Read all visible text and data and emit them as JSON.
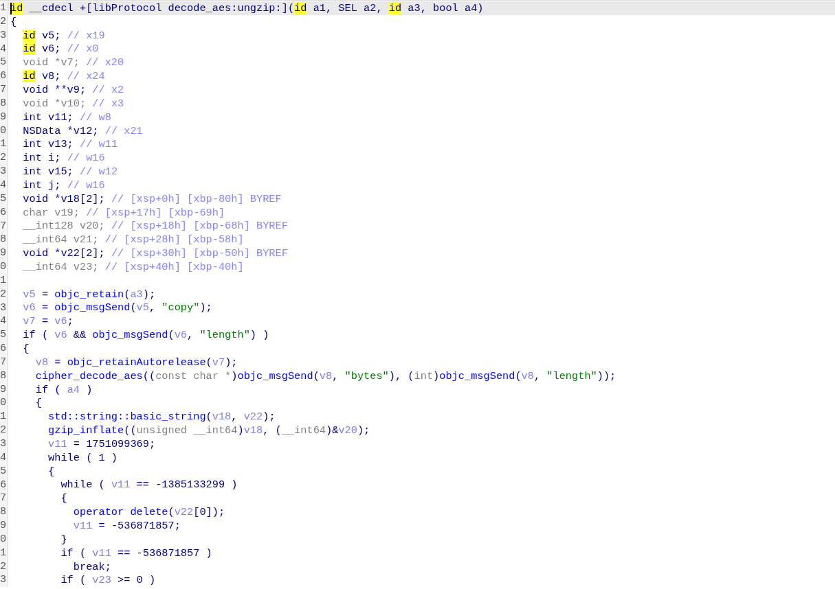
{
  "lines": [
    {
      "number": "1",
      "current": true,
      "tokens": [
        {
          "kind": "hl",
          "text": "id"
        },
        {
          "kind": "plain",
          "text": " __cdecl +[libProtocol decode_aes:ungzip:]("
        },
        {
          "kind": "hl",
          "text": "id"
        },
        {
          "kind": "plain",
          "text": " a1, SEL a2, "
        },
        {
          "kind": "hl",
          "text": "id"
        },
        {
          "kind": "plain",
          "text": " a3, bool a4)"
        }
      ]
    },
    {
      "number": "2",
      "current": false,
      "tokens": [
        {
          "kind": "plain",
          "text": "{"
        }
      ]
    },
    {
      "number": "3",
      "current": false,
      "tokens": [
        {
          "kind": "hl",
          "text": "  id"
        },
        {
          "kind": "plain",
          "text": " v5; "
        },
        {
          "kind": "comment",
          "text": "// x19"
        }
      ]
    },
    {
      "number": "4",
      "current": false,
      "tokens": [
        {
          "kind": "hl",
          "text": "  id"
        },
        {
          "kind": "plain",
          "text": " v6; "
        },
        {
          "kind": "comment",
          "text": "// x0"
        }
      ]
    },
    {
      "number": "5",
      "current": false,
      "tokens": [
        {
          "kind": "grey",
          "text": "  void *v7; "
        },
        {
          "kind": "comment",
          "text": "// x20"
        }
      ]
    },
    {
      "number": "6",
      "current": false,
      "tokens": [
        {
          "kind": "hl",
          "text": "  id"
        },
        {
          "kind": "plain",
          "text": " v8; "
        },
        {
          "kind": "comment",
          "text": "// x24"
        }
      ]
    },
    {
      "number": "7",
      "current": false,
      "tokens": [
        {
          "kind": "plain",
          "text": "  void **v9; "
        },
        {
          "kind": "comment",
          "text": "// x2"
        }
      ]
    },
    {
      "number": "8",
      "current": false,
      "tokens": [
        {
          "kind": "grey",
          "text": "  void *v10; "
        },
        {
          "kind": "comment",
          "text": "// x3"
        }
      ]
    },
    {
      "number": "9",
      "current": false,
      "tokens": [
        {
          "kind": "plain",
          "text": "  int v11; "
        },
        {
          "kind": "comment",
          "text": "// w8"
        }
      ]
    },
    {
      "number": "0",
      "current": false,
      "tokens": [
        {
          "kind": "plain",
          "text": "  NSData *v12; "
        },
        {
          "kind": "comment",
          "text": "// x21"
        }
      ]
    },
    {
      "number": "1",
      "current": false,
      "tokens": [
        {
          "kind": "plain",
          "text": "  int v13; "
        },
        {
          "kind": "comment",
          "text": "// w11"
        }
      ]
    },
    {
      "number": "2",
      "current": false,
      "tokens": [
        {
          "kind": "plain",
          "text": "  int i; "
        },
        {
          "kind": "comment",
          "text": "// w16"
        }
      ]
    },
    {
      "number": "3",
      "current": false,
      "tokens": [
        {
          "kind": "plain",
          "text": "  int v15; "
        },
        {
          "kind": "comment",
          "text": "// w12"
        }
      ]
    },
    {
      "number": "4",
      "current": false,
      "tokens": [
        {
          "kind": "plain",
          "text": "  int j; "
        },
        {
          "kind": "comment",
          "text": "// w16"
        }
      ]
    },
    {
      "number": "5",
      "current": false,
      "tokens": [
        {
          "kind": "plain",
          "text": "  void *v18[2]; "
        },
        {
          "kind": "comment",
          "text": "// [xsp+0h] [xbp-80h] BYREF"
        }
      ]
    },
    {
      "number": "6",
      "current": false,
      "tokens": [
        {
          "kind": "grey",
          "text": "  char v19; "
        },
        {
          "kind": "comment",
          "text": "// [xsp+17h] [xbp-69h]"
        }
      ]
    },
    {
      "number": "7",
      "current": false,
      "tokens": [
        {
          "kind": "grey",
          "text": "  __int128 v20; "
        },
        {
          "kind": "comment",
          "text": "// [xsp+18h] [xbp-68h] BYREF"
        }
      ]
    },
    {
      "number": "8",
      "current": false,
      "tokens": [
        {
          "kind": "grey",
          "text": "  __int64 v21; "
        },
        {
          "kind": "comment",
          "text": "// [xsp+28h] [xbp-58h]"
        }
      ]
    },
    {
      "number": "9",
      "current": false,
      "tokens": [
        {
          "kind": "plain",
          "text": "  void *v22[2]; "
        },
        {
          "kind": "comment",
          "text": "// [xsp+30h] [xbp-50h] BYREF"
        }
      ]
    },
    {
      "number": "0",
      "current": false,
      "tokens": [
        {
          "kind": "grey",
          "text": "  __int64 v23; "
        },
        {
          "kind": "comment",
          "text": "// [xsp+40h] [xbp-40h]"
        }
      ]
    },
    {
      "number": "1",
      "current": false
    },
    {
      "number": "2",
      "current": false,
      "tokens": [
        {
          "kind": "var",
          "text": "  v5"
        },
        {
          "kind": "plain",
          "text": " = "
        },
        {
          "kind": "func",
          "text": "objc_retain"
        },
        {
          "kind": "plain",
          "text": "("
        },
        {
          "kind": "var",
          "text": "a3"
        },
        {
          "kind": "plain",
          "text": ");"
        }
      ]
    },
    {
      "number": "3",
      "current": false,
      "tokens": [
        {
          "kind": "var",
          "text": "  v6"
        },
        {
          "kind": "plain",
          "text": " = "
        },
        {
          "kind": "func",
          "text": "objc_msgSend"
        },
        {
          "kind": "plain",
          "text": "("
        },
        {
          "kind": "var",
          "text": "v5"
        },
        {
          "kind": "plain",
          "text": ", "
        },
        {
          "kind": "string",
          "text": "\"copy\""
        },
        {
          "kind": "plain",
          "text": ");"
        }
      ]
    },
    {
      "number": "4",
      "current": false,
      "tokens": [
        {
          "kind": "var",
          "text": "  v7"
        },
        {
          "kind": "plain",
          "text": " = "
        },
        {
          "kind": "var",
          "text": "v6"
        },
        {
          "kind": "plain",
          "text": ";"
        }
      ]
    },
    {
      "number": "5",
      "current": false,
      "tokens": [
        {
          "kind": "plain",
          "text": "  if ( "
        },
        {
          "kind": "var",
          "text": "v6"
        },
        {
          "kind": "plain",
          "text": " && "
        },
        {
          "kind": "func",
          "text": "objc_msgSend"
        },
        {
          "kind": "plain",
          "text": "("
        },
        {
          "kind": "var",
          "text": "v6"
        },
        {
          "kind": "plain",
          "text": ", "
        },
        {
          "kind": "string",
          "text": "\"length\""
        },
        {
          "kind": "plain",
          "text": ") )"
        }
      ]
    },
    {
      "number": "6",
      "current": false,
      "tokens": [
        {
          "kind": "plain",
          "text": "  {"
        }
      ]
    },
    {
      "number": "7",
      "current": false,
      "tokens": [
        {
          "kind": "var",
          "text": "    v8"
        },
        {
          "kind": "plain",
          "text": " = "
        },
        {
          "kind": "func",
          "text": "objc_retainAutorelease"
        },
        {
          "kind": "plain",
          "text": "("
        },
        {
          "kind": "var",
          "text": "v7"
        },
        {
          "kind": "plain",
          "text": ");"
        }
      ]
    },
    {
      "number": "8",
      "current": false,
      "tokens": [
        {
          "kind": "func",
          "text": "    cipher_decode_aes"
        },
        {
          "kind": "plain",
          "text": "(("
        },
        {
          "kind": "grey",
          "text": "const char *"
        },
        {
          "kind": "plain",
          "text": ")"
        },
        {
          "kind": "func",
          "text": "objc_msgSend"
        },
        {
          "kind": "plain",
          "text": "("
        },
        {
          "kind": "var",
          "text": "v8"
        },
        {
          "kind": "plain",
          "text": ", "
        },
        {
          "kind": "string",
          "text": "\"bytes\""
        },
        {
          "kind": "plain",
          "text": "), ("
        },
        {
          "kind": "grey",
          "text": "int"
        },
        {
          "kind": "plain",
          "text": ")"
        },
        {
          "kind": "func",
          "text": "objc_msgSend"
        },
        {
          "kind": "plain",
          "text": "("
        },
        {
          "kind": "var",
          "text": "v8"
        },
        {
          "kind": "plain",
          "text": ", "
        },
        {
          "kind": "string",
          "text": "\"length\""
        },
        {
          "kind": "plain",
          "text": "));"
        }
      ]
    },
    {
      "number": "9",
      "current": false,
      "tokens": [
        {
          "kind": "plain",
          "text": "    if ( "
        },
        {
          "kind": "var",
          "text": "a4"
        },
        {
          "kind": "plain",
          "text": " )"
        }
      ]
    },
    {
      "number": "0",
      "current": false,
      "tokens": [
        {
          "kind": "plain",
          "text": "    {"
        }
      ]
    },
    {
      "number": "1",
      "current": false,
      "tokens": [
        {
          "kind": "func",
          "text": "      std::string::basic_string"
        },
        {
          "kind": "plain",
          "text": "("
        },
        {
          "kind": "var",
          "text": "v18"
        },
        {
          "kind": "plain",
          "text": ", "
        },
        {
          "kind": "var",
          "text": "v22"
        },
        {
          "kind": "plain",
          "text": ");"
        }
      ]
    },
    {
      "number": "2",
      "current": false,
      "tokens": [
        {
          "kind": "func",
          "text": "      gzip_inflate"
        },
        {
          "kind": "plain",
          "text": "(("
        },
        {
          "kind": "grey",
          "text": "unsigned __int64"
        },
        {
          "kind": "plain",
          "text": ")"
        },
        {
          "kind": "var",
          "text": "v18"
        },
        {
          "kind": "plain",
          "text": ", ("
        },
        {
          "kind": "grey",
          "text": "__int64"
        },
        {
          "kind": "plain",
          "text": ")&"
        },
        {
          "kind": "var",
          "text": "v20"
        },
        {
          "kind": "plain",
          "text": ");"
        }
      ]
    },
    {
      "number": "3",
      "current": false,
      "tokens": [
        {
          "kind": "var",
          "text": "      v11"
        },
        {
          "kind": "plain",
          "text": " = 1751099369;"
        }
      ]
    },
    {
      "number": "4",
      "current": false,
      "tokens": [
        {
          "kind": "plain",
          "text": "      while ( 1 )"
        }
      ]
    },
    {
      "number": "5",
      "current": false,
      "tokens": [
        {
          "kind": "plain",
          "text": "      {"
        }
      ]
    },
    {
      "number": "6",
      "current": false,
      "tokens": [
        {
          "kind": "plain",
          "text": "        while ( "
        },
        {
          "kind": "var",
          "text": "v11"
        },
        {
          "kind": "plain",
          "text": " == -1385133299 )"
        }
      ]
    },
    {
      "number": "7",
      "current": false,
      "tokens": [
        {
          "kind": "plain",
          "text": "        {"
        }
      ]
    },
    {
      "number": "8",
      "current": false,
      "tokens": [
        {
          "kind": "func",
          "text": "          operator delete"
        },
        {
          "kind": "plain",
          "text": "("
        },
        {
          "kind": "var",
          "text": "v22"
        },
        {
          "kind": "plain",
          "text": "[0]);"
        }
      ]
    },
    {
      "number": "9",
      "current": false,
      "tokens": [
        {
          "kind": "var",
          "text": "          v11"
        },
        {
          "kind": "plain",
          "text": " = -536871857;"
        }
      ]
    },
    {
      "number": "0",
      "current": false,
      "tokens": [
        {
          "kind": "plain",
          "text": "        }"
        }
      ]
    },
    {
      "number": "1",
      "current": false,
      "tokens": [
        {
          "kind": "plain",
          "text": "        if ( "
        },
        {
          "kind": "var",
          "text": "v11"
        },
        {
          "kind": "plain",
          "text": " == -536871857 )"
        }
      ]
    },
    {
      "number": "2",
      "current": false,
      "tokens": [
        {
          "kind": "plain",
          "text": "          break;"
        }
      ]
    },
    {
      "number": "3",
      "current": false,
      "tokens": [
        {
          "kind": "plain",
          "text": "        if ( "
        },
        {
          "kind": "var",
          "text": "v23"
        },
        {
          "kind": "plain",
          "text": " >= 0 )"
        }
      ]
    }
  ]
}
